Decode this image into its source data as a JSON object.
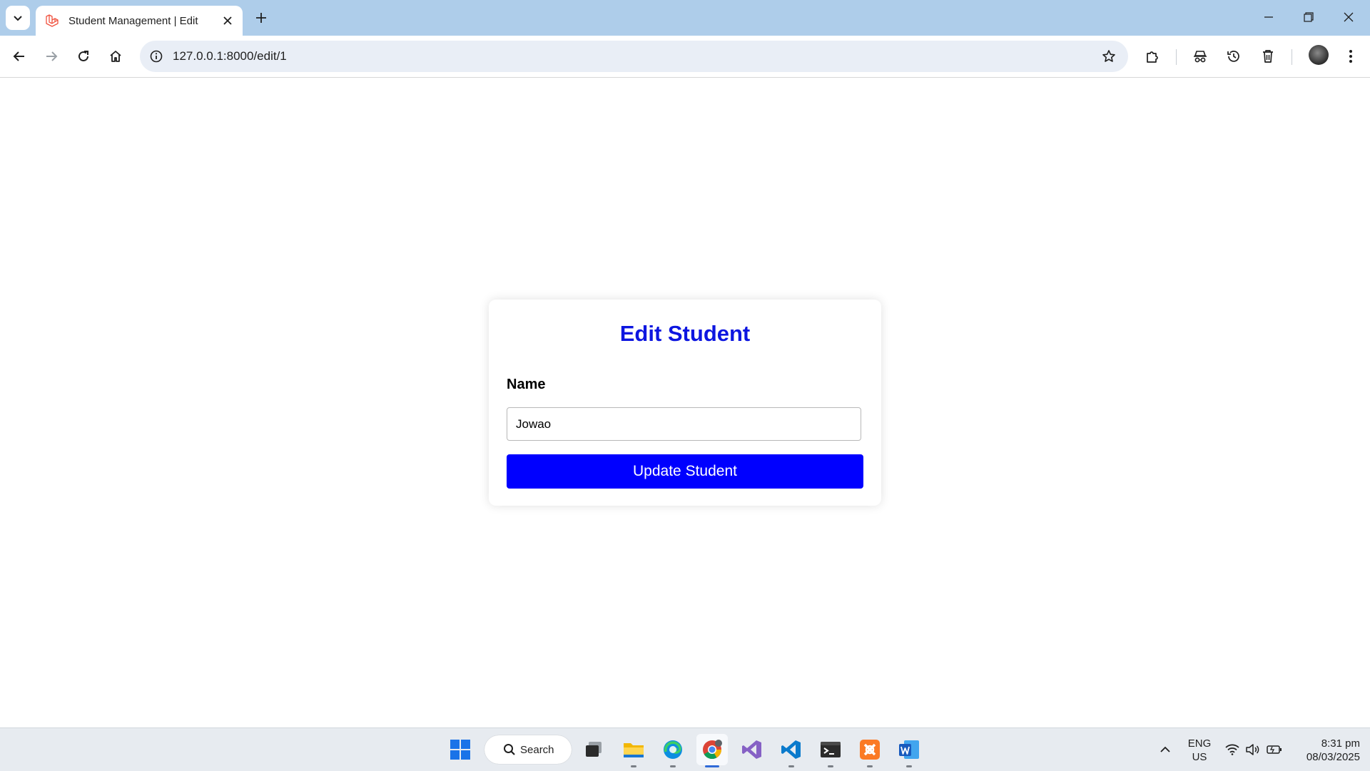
{
  "browser": {
    "tab_title": "Student Management | Edit",
    "url": "127.0.0.1:8000/edit/1"
  },
  "form": {
    "heading": "Edit Student",
    "name_label": "Name",
    "name_value": "Jowao",
    "submit_label": "Update Student",
    "colors": {
      "heading": "#0d16e0",
      "button": "#0000ff"
    }
  },
  "taskbar": {
    "search_label": "Search",
    "language_line1": "ENG",
    "language_line2": "US",
    "time": "8:31 pm",
    "date": "08/03/2025",
    "apps": [
      "start-icon",
      "task-view-icon",
      "file-explorer-icon",
      "edge-icon",
      "chrome-icon",
      "visual-studio-icon",
      "vscode-icon",
      "terminal-icon",
      "xampp-icon",
      "word-icon"
    ]
  }
}
